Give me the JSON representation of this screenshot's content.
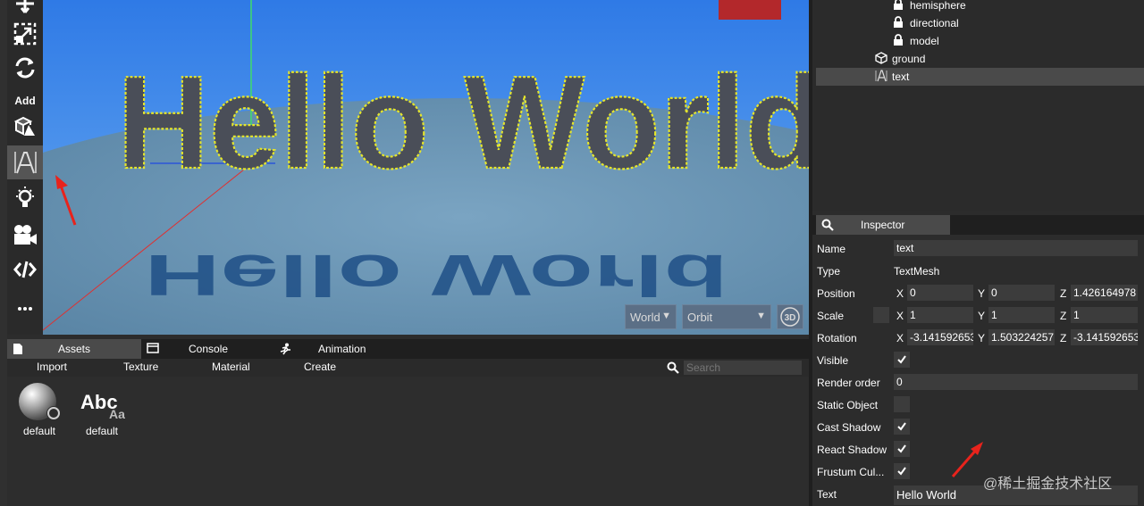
{
  "toolbar": {
    "add_label": "Add",
    "icons": [
      "move-icon",
      "scale-icon",
      "rotate-icon",
      "box-icon",
      "text-icon",
      "light-icon",
      "camera-icon",
      "code-icon",
      "more-icon"
    ]
  },
  "viewport": {
    "scene_text": "Hello World",
    "space_select": "World",
    "camera_select": "Orbit",
    "view_badge": "3D"
  },
  "bottom_panel": {
    "tabs": [
      {
        "label": "Assets"
      },
      {
        "label": "Console"
      },
      {
        "label": "Animation"
      }
    ],
    "menu": {
      "import": "Import",
      "texture": "Texture",
      "material": "Material",
      "create": "Create"
    },
    "search_placeholder": "Search",
    "assets": [
      {
        "label": "default",
        "kind": "material"
      },
      {
        "label": "default",
        "kind": "font",
        "glyph_big": "Abc",
        "glyph_small": "Aa"
      }
    ]
  },
  "hierarchy": {
    "items": [
      {
        "label": "hemisphere",
        "icon": "lock-icon"
      },
      {
        "label": "directional",
        "icon": "lock-icon"
      },
      {
        "label": "model",
        "icon": "lock-icon"
      },
      {
        "label": "ground",
        "icon": "cube-icon"
      },
      {
        "label": "text",
        "icon": "text-icon",
        "selected": true
      }
    ]
  },
  "inspector": {
    "tab_label": "Inspector",
    "name_label": "Name",
    "name_value": "text",
    "type_label": "Type",
    "type_value": "TextMesh",
    "position_label": "Position",
    "position": {
      "x": "0",
      "y": "0",
      "z": "1.426164978"
    },
    "scale_label": "Scale",
    "scale": {
      "x": "1",
      "y": "1",
      "z": "1"
    },
    "rotation_label": "Rotation",
    "rotation": {
      "x": "-3.141592653",
      "y": "1.503224257",
      "z": "-3.141592653"
    },
    "axis_x": "X",
    "axis_y": "Y",
    "axis_z": "Z",
    "visible_label": "Visible",
    "visible": true,
    "render_order_label": "Render order",
    "render_order_value": "0",
    "static_object_label": "Static Object",
    "static_object": false,
    "cast_shadow_label": "Cast Shadow",
    "cast_shadow": true,
    "react_shadow_label": "React Shadow",
    "react_shadow": true,
    "frustum_label": "Frustum Cul...",
    "frustum": true,
    "text_label": "Text",
    "text_value": "Hello World"
  },
  "watermark": "@稀土掘金技术社区",
  "colors": {
    "accent_red": "#e8231c",
    "wire_yellow": "#e6e62a",
    "mesh_gray": "#4a4e58"
  }
}
